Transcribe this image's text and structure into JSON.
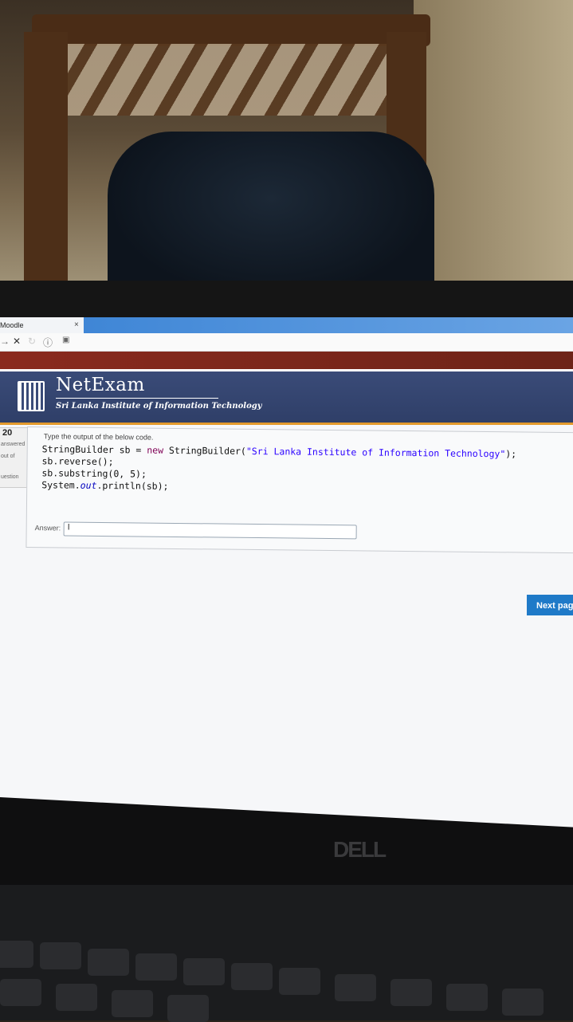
{
  "browser": {
    "tab_title": "Moodle",
    "tab_close": "×",
    "nav_icons": [
      "back-arrow-icon",
      "stop-icon",
      "reload-icon",
      "info-icon",
      "page-icon"
    ]
  },
  "header": {
    "title": "NetExam",
    "subtitle": "Sri Lanka Institute of Information Technology"
  },
  "question_info": {
    "number": "20",
    "status": "answered",
    "marks": "out of",
    "flag": "uestion"
  },
  "question": {
    "prompt": "Type the output of the below code.",
    "code": {
      "line1_type": "StringBuilder sb = ",
      "line1_kw": "new",
      "line1_ctor": " StringBuilder(",
      "line1_str": "\"Sri Lanka Institute of Information Technology\"",
      "line1_end": ");",
      "line2": "sb.reverse();",
      "line3": "sb.substring(0, 5);",
      "line4_start": "System.",
      "line4_out": "out",
      "line4_end": ".println(sb);"
    },
    "answer_label": "Answer:",
    "answer_value": "I"
  },
  "actions": {
    "next_label": "Next pag"
  },
  "device": {
    "brand": "DELL"
  },
  "colors": {
    "banner": "#3a4b78",
    "accent_orange": "#e39a2c",
    "button_blue": "#1f7ac8",
    "title_bar_red": "#8a2a1e"
  }
}
